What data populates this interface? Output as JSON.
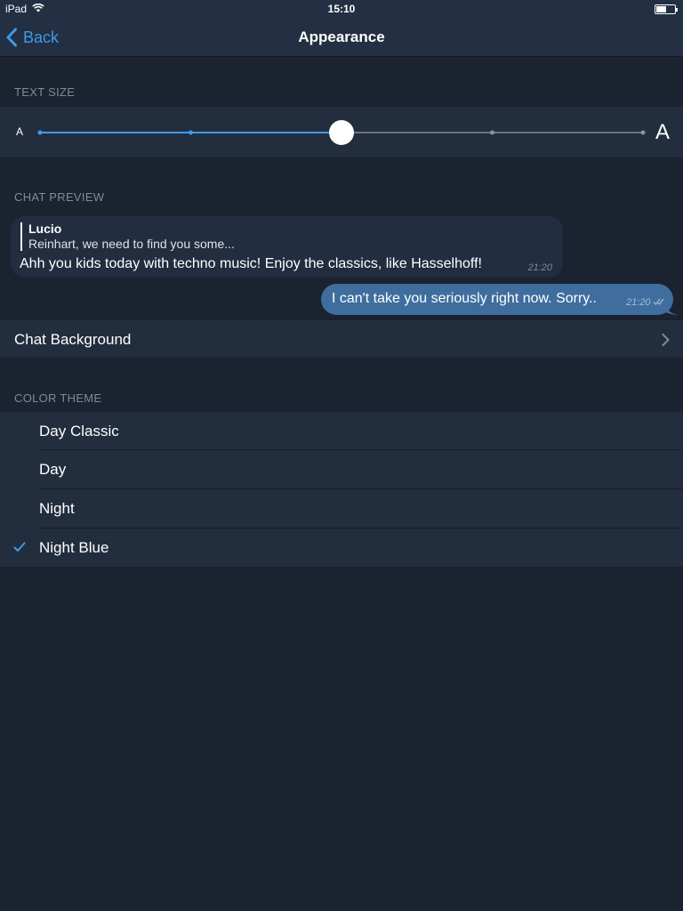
{
  "status_bar": {
    "device": "iPad",
    "time": "15:10"
  },
  "nav": {
    "back_label": "Back",
    "title": "Appearance"
  },
  "text_size": {
    "header": "TEXT SIZE",
    "small_glyph": "A",
    "large_glyph": "A",
    "steps": 5,
    "selected_step": 3,
    "accent_color": "#3e9be6"
  },
  "chat_preview": {
    "header": "CHAT PREVIEW",
    "incoming": {
      "reply_name": "Lucio",
      "reply_text": "Reinhart, we need to find you some...",
      "text": "Ahh you kids today with techno music! Enjoy the classics, like Hasselhoff!",
      "time": "21:20"
    },
    "outgoing": {
      "text": "I can't take you seriously right now. Sorry..",
      "time": "21:20",
      "status_icon": "double-check-icon"
    }
  },
  "chat_background": {
    "label": "Chat Background",
    "icon": "chevron-right-icon"
  },
  "color_theme": {
    "header": "COLOR THEME",
    "options": [
      {
        "label": "Day Classic",
        "selected": false
      },
      {
        "label": "Day",
        "selected": false
      },
      {
        "label": "Night",
        "selected": false
      },
      {
        "label": "Night Blue",
        "selected": true
      }
    ]
  },
  "colors": {
    "background": "#1b2230",
    "cell": "#222d3e",
    "accent": "#3e9be6",
    "outgoing_bubble": "#3f6e9e",
    "section_text": "#7f8a9a"
  }
}
